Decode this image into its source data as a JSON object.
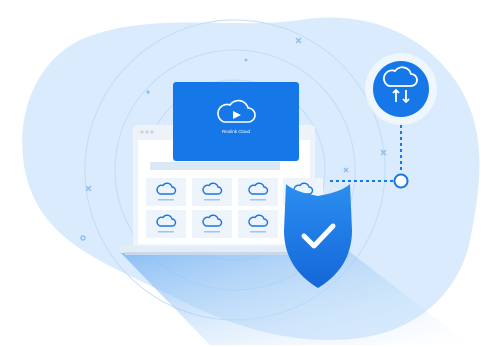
{
  "illustration": {
    "popup": {
      "label": "Reolink Cloud",
      "icon": "cloud-play-icon"
    },
    "shield_icon": "shield-check-icon",
    "sync_icon": "cloud-sync-icon",
    "tile_icon": "cloud-camera-icon",
    "colors": {
      "primary": "#1677e8",
      "primary_dark": "#0f5fcf",
      "blob": "#d9ebfc",
      "blob_dark": "#c7e0fb",
      "tile_bg": "#eef4fb",
      "laptop_frame": "#eef3f9"
    }
  }
}
